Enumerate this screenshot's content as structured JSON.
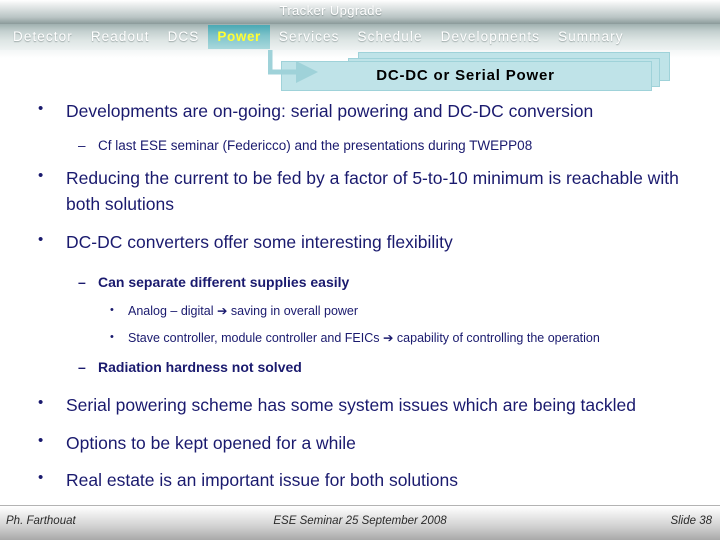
{
  "deck": {
    "title": "Tracker Upgrade"
  },
  "nav": {
    "items": [
      {
        "label": "Detector",
        "active": false
      },
      {
        "label": "Readout",
        "active": false
      },
      {
        "label": "DCS",
        "active": false
      },
      {
        "label": "Power",
        "active": true
      },
      {
        "label": "Services",
        "active": false
      },
      {
        "label": "Schedule",
        "active": false
      },
      {
        "label": "Developments",
        "active": false
      },
      {
        "label": "Summary",
        "active": false
      }
    ],
    "active_label": "Power",
    "active_text_color": "#ffff33",
    "active_bg_color": "#7fc4cb",
    "text_color": "#ffffff"
  },
  "banner": {
    "title": "DC-DC or Serial Power",
    "fill_color": "#bfe3e8",
    "border_color": "#9fd2d9",
    "connector_color": "#9fd2d9"
  },
  "content": {
    "text_color": "#1a1a6e",
    "blocks": [
      {
        "level": 1,
        "marker": "•",
        "text": "Developments are on-going: serial powering and DC-DC conversion"
      },
      {
        "level": 2,
        "marker": "–",
        "text": "Cf last ESE seminar (Federicco) and the presentations during TWEPP08"
      },
      {
        "level": 1,
        "marker": "•",
        "text": "Reducing the current to be fed by a factor of 5-to-10 minimum is reachable with both solutions"
      },
      {
        "level": 1,
        "marker": "•",
        "text": "DC-DC converters offer some interesting flexibility"
      },
      {
        "level": 2,
        "marker": "–",
        "bold": true,
        "text": "Can separate different supplies easily"
      },
      {
        "level": 3,
        "marker": "•",
        "text": "Analog – digital ➔ saving in overall power"
      },
      {
        "level": 3,
        "marker": "•",
        "text": "Stave controller, module controller and FEICs ➔ capability of controlling the operation"
      },
      {
        "level": 2,
        "marker": "–",
        "bold": true,
        "text": "Radiation hardness not solved"
      },
      {
        "level": 1,
        "marker": "•",
        "text": "Serial powering scheme has some system issues which are being tackled"
      },
      {
        "level": 1,
        "marker": "•",
        "text": "Options to be kept opened for a while"
      },
      {
        "level": 1,
        "marker": "•",
        "text": "Real estate is an important issue for both solutions"
      }
    ]
  },
  "footer": {
    "author": "Ph. Farthouat",
    "event": "ESE Seminar 25 September 2008",
    "slide_number": "Slide 38"
  }
}
